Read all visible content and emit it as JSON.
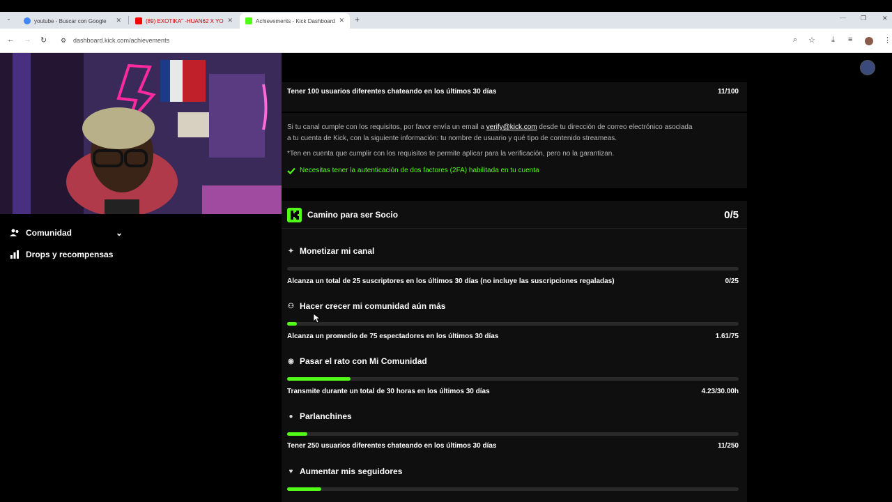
{
  "browser": {
    "tabs": [
      {
        "label": "youtube - Buscar con Google",
        "favicon_color": "#4285f4"
      },
      {
        "label": "(89) EXOTIKA\" -HUAN62 X YO",
        "favicon_color": "#ff0000"
      },
      {
        "label": "Achievements - Kick Dashboard",
        "favicon_color": "#53fc18"
      }
    ],
    "new_tab_symbol": "+",
    "url": "dashboard.kick.com/achievements"
  },
  "sidebar": {
    "items": [
      {
        "label": "Comunidad",
        "icon": "community-icon"
      },
      {
        "label": "Drops y recompensas",
        "icon": "drops-icon"
      }
    ]
  },
  "verification": {
    "top_requirement": "Tener 100 usuarios diferentes chateando en los últimos 30 días",
    "top_progress": "11/100",
    "info_part1": "Si tu canal cumple con los requisitos, por favor envía un email a ",
    "email": "verify@kick.com",
    "info_part2": " desde tu dirección de correo electrónico asociada",
    "info_line2": "a tu cuenta de Kick, con la siguiente información: tu nombre de usuario y qué tipo de contenido streameas.",
    "note": "*Ten en cuenta que cumplir con los requisitos te permite aplicar para la verificación, pero no la garantizan.",
    "twofa": "Necesitas tener la autenticación de dos factores (2FA) habilitada en tu cuenta"
  },
  "partner": {
    "title": "Camino para ser Socio",
    "progress": "0/5",
    "sections": [
      {
        "title": "Monetizar mi canal",
        "icon": "sparkle-icon",
        "description": "Alcanza un total de 25 suscriptores en los últimos 30 días (no incluye las suscripciones regaladas)",
        "value": "0/25",
        "fill_fraction": 0.0
      },
      {
        "title": "Hacer crecer mi comunidad aún más",
        "icon": "users-icon",
        "description": "Alcanza un promedio de 75 espectadores en los últimos 30 días",
        "value": "1.61/75",
        "fill_fraction": 0.021
      },
      {
        "title": "Pasar el rato con Mi Comunidad",
        "icon": "broadcast-icon",
        "description": "Transmite durante un total de 30 horas en los últimos 30 días",
        "value": "4.23/30.00h",
        "fill_fraction": 0.141
      },
      {
        "title": "Parlanchines",
        "icon": "chat-icon",
        "description": "Tener 250 usuarios diferentes chateando en los últimos 30 días",
        "value": "11/250",
        "fill_fraction": 0.044
      },
      {
        "title": "Aumentar mis seguidores",
        "icon": "heart-icon",
        "description": "",
        "value": "",
        "fill_fraction": 0.075
      }
    ]
  },
  "colors": {
    "accent": "#53fc18",
    "card_bg": "#0f0f0f",
    "page_bg": "#000000"
  }
}
